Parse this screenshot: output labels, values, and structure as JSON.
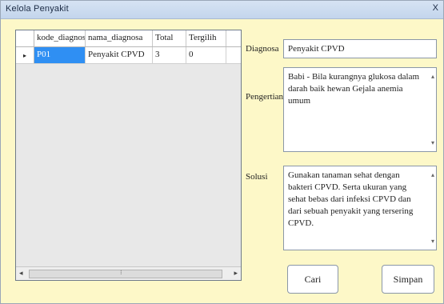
{
  "window": {
    "title": "Kelola Penyakit",
    "close_label": "X"
  },
  "grid": {
    "columns": [
      "kode_diagnosa",
      "nama_diagnosa",
      "Total",
      "Tergilih"
    ],
    "rows": [
      {
        "indicator": "▸",
        "kode": "P01",
        "nama": "Penyakit CPVD",
        "total": "3",
        "tergilih": "0"
      }
    ]
  },
  "form": {
    "diagnosa_label": "Diagnosa",
    "diagnosa_value": "Penyakit CPVD",
    "pengertian_label": "Pengertian",
    "pengertian_value": "Babi - Bila kurangnya glukosa dalam darah baik hewan Gejala anemia umum",
    "solusi_label": "Solusi",
    "solusi_value": "Gunakan tanaman sehat dengan bakteri CPVD. Serta ukuran yang sehat bebas dari infeksi CPVD dan dari sebuah penyakit yang tersering CPVD."
  },
  "buttons": {
    "cari": "Cari",
    "simpan": "Simpan"
  }
}
